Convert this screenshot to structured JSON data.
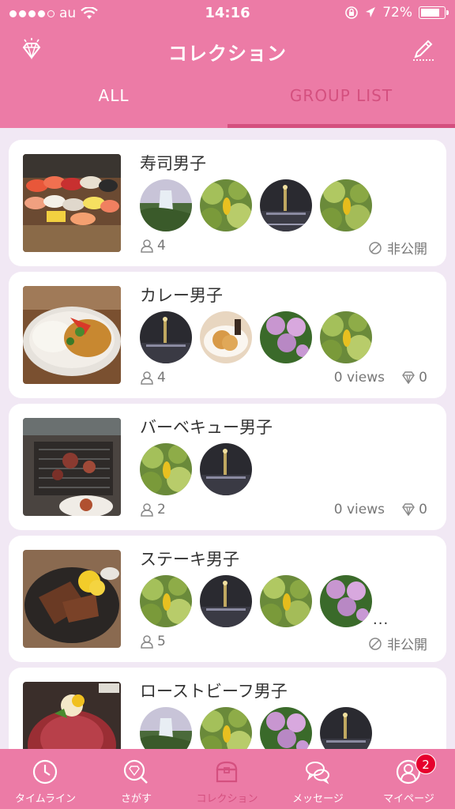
{
  "status_bar": {
    "carrier": "au",
    "time": "14:16",
    "battery": "72%"
  },
  "header": {
    "title": "コレクション",
    "left_icon": "diamond-icon",
    "right_icon": "edit-icon"
  },
  "tabs": [
    {
      "label": "ALL",
      "active": false
    },
    {
      "label": "GROUP LIST",
      "active": true
    }
  ],
  "collections": [
    {
      "title": "寿司男子",
      "members": "4",
      "privacy": "非公開",
      "more": ""
    },
    {
      "title": "カレー男子",
      "members": "4",
      "views": "0 views",
      "gems": "0"
    },
    {
      "title": "バーベキュー男子",
      "members": "2",
      "views": "0 views",
      "gems": "0"
    },
    {
      "title": "ステーキ男子",
      "members": "5",
      "privacy": "非公開",
      "more": "..."
    },
    {
      "title": "ローストビーフ男子",
      "members": "",
      "privacy": ""
    }
  ],
  "bottom_nav": [
    {
      "label": "タイムライン",
      "icon": "clock-icon"
    },
    {
      "label": "さがす",
      "icon": "search-diamond-icon"
    },
    {
      "label": "コレクション",
      "icon": "treasure-box-icon",
      "active": true
    },
    {
      "label": "メッセージ",
      "icon": "chat-bubbles-icon"
    },
    {
      "label": "マイページ",
      "icon": "user-icon",
      "badge": "2"
    }
  ],
  "colors": {
    "accent": "#ec7ba6",
    "active": "#d4507f",
    "badge": "#e6002d"
  }
}
